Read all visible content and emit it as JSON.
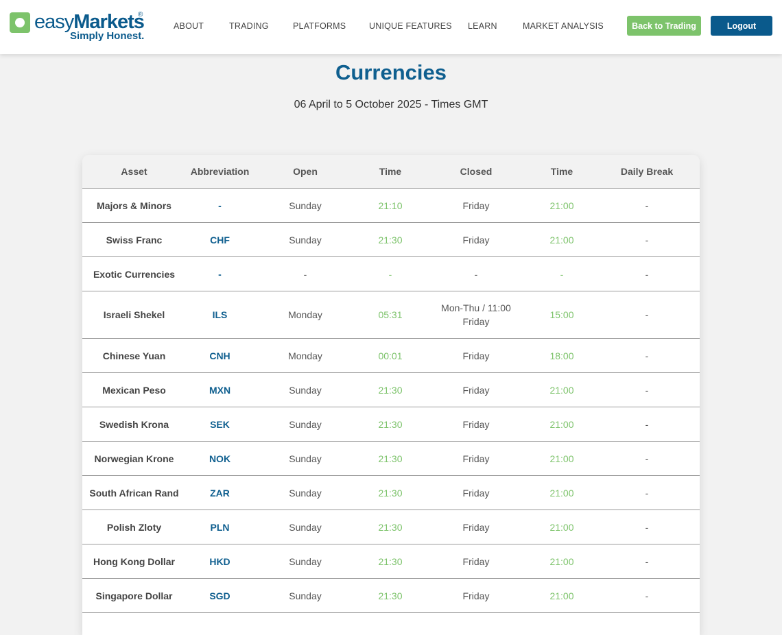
{
  "brand": {
    "easy": "easy",
    "markets": "Markets",
    "reg": "®",
    "tagline": "Simply Honest."
  },
  "nav": [
    "ABOUT",
    "TRADING",
    "PLATFORMS",
    "UNIQUE FEATURES",
    "LEARN",
    "MARKET ANALYSIS"
  ],
  "buttons": {
    "back": "Back to Trading",
    "logout": "Logout"
  },
  "colors": {
    "brand_blue": "#0a5a8c",
    "brand_green": "#7dc36b",
    "background": "#f2f2f2"
  },
  "page": {
    "title": "Currencies",
    "subtitle": "06 April to 5 October 2025 - Times GMT"
  },
  "table": {
    "columns": [
      "Asset",
      "Abbreviation",
      "Open",
      "Time",
      "Closed",
      "Time",
      "Daily Break"
    ],
    "rows": [
      {
        "asset": "Majors & Minors",
        "abbr": "-",
        "open": "Sunday",
        "open_time": "21:10",
        "closed": "Friday",
        "closed_time": "21:00",
        "break": "-"
      },
      {
        "asset": "Swiss Franc",
        "abbr": "CHF",
        "open": "Sunday",
        "open_time": "21:30",
        "closed": "Friday",
        "closed_time": "21:00",
        "break": "-"
      },
      {
        "asset": "Exotic Currencies",
        "abbr": "-",
        "open": "-",
        "open_time": "-",
        "closed": "-",
        "closed_time": "-",
        "break": "-"
      },
      {
        "asset": "Israeli Shekel",
        "abbr": "ILS",
        "open": "Monday",
        "open_time": "05:31",
        "closed": "Mon-Thu / 11:00",
        "closed2": "Friday",
        "closed_time": "15:00",
        "break": "-"
      },
      {
        "asset": "Chinese Yuan",
        "abbr": "CNH",
        "open": "Monday",
        "open_time": "00:01",
        "closed": "Friday",
        "closed_time": "18:00",
        "break": "-"
      },
      {
        "asset": "Mexican Peso",
        "abbr": "MXN",
        "open": "Sunday",
        "open_time": "21:30",
        "closed": "Friday",
        "closed_time": "21:00",
        "break": "-"
      },
      {
        "asset": "Swedish Krona",
        "abbr": "SEK",
        "open": "Sunday",
        "open_time": "21:30",
        "closed": "Friday",
        "closed_time": "21:00",
        "break": "-"
      },
      {
        "asset": "Norwegian Krone",
        "abbr": "NOK",
        "open": "Sunday",
        "open_time": "21:30",
        "closed": "Friday",
        "closed_time": "21:00",
        "break": "-"
      },
      {
        "asset": "South African Rand",
        "abbr": "ZAR",
        "open": "Sunday",
        "open_time": "21:30",
        "closed": "Friday",
        "closed_time": "21:00",
        "break": "-"
      },
      {
        "asset": "Polish Zloty",
        "abbr": "PLN",
        "open": "Sunday",
        "open_time": "21:30",
        "closed": "Friday",
        "closed_time": "21:00",
        "break": "-"
      },
      {
        "asset": "Hong Kong Dollar",
        "abbr": "HKD",
        "open": "Sunday",
        "open_time": "21:30",
        "closed": "Friday",
        "closed_time": "21:00",
        "break": "-"
      },
      {
        "asset": "Singapore Dollar",
        "abbr": "SGD",
        "open": "Sunday",
        "open_time": "21:30",
        "closed": "Friday",
        "closed_time": "21:00",
        "break": "-"
      }
    ]
  }
}
